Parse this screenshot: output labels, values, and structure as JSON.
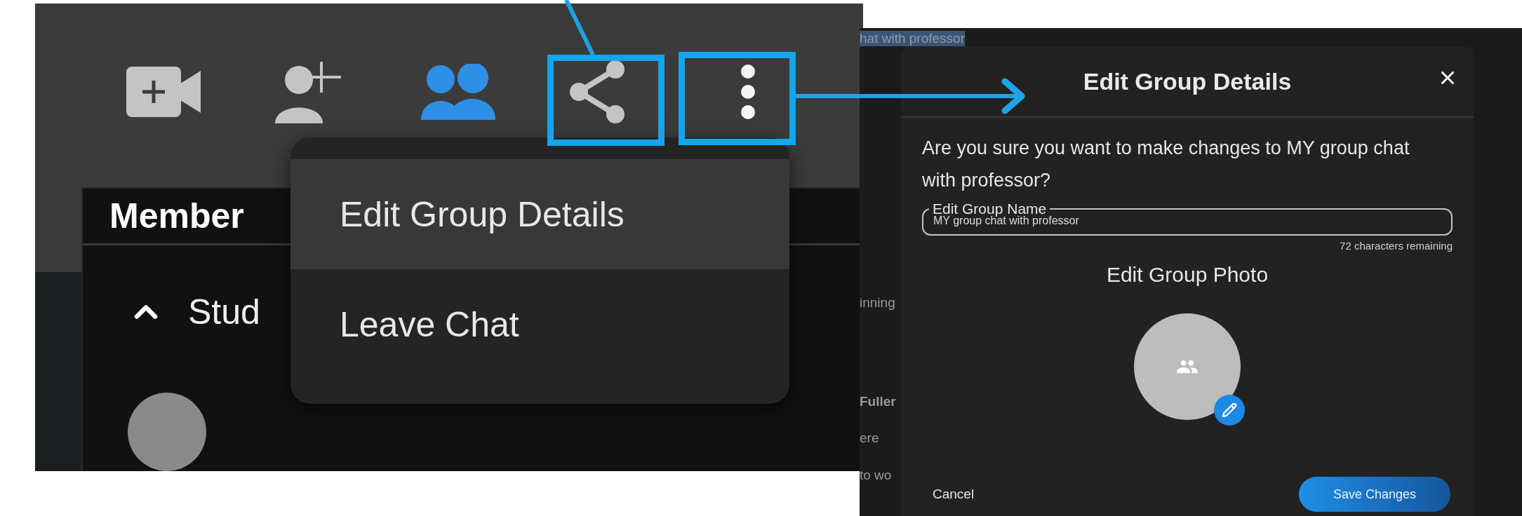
{
  "left_screen": {
    "toolbar": [
      {
        "kind": "video-add",
        "selected": false
      },
      {
        "kind": "person-add",
        "selected": false
      },
      {
        "kind": "members",
        "selected": true
      },
      {
        "kind": "share",
        "selected": false
      },
      {
        "kind": "more",
        "selected": false
      }
    ],
    "members_panel": {
      "title": "Member",
      "section": {
        "label": "Stud",
        "expanded": true
      }
    },
    "menu": {
      "items": [
        {
          "label": "Edit Group Details",
          "selected": true
        },
        {
          "label": "Leave Chat",
          "selected": false
        }
      ]
    }
  },
  "right_screen": {
    "selected_text": "hat with professor",
    "background_texts": [
      {
        "text": "inning",
        "kind": "text"
      },
      {
        "text": "Fuller",
        "kind": "name"
      },
      {
        "text": "ere",
        "kind": "text"
      },
      {
        "text": "to wo",
        "kind": "text"
      }
    ],
    "dialog": {
      "title": "Edit Group Details",
      "message": "Are you sure you want to make changes to MY group chat with professor?",
      "name_field": {
        "label": "Edit Group Name",
        "value": "MY group chat with professor",
        "counter": "72 characters remaining"
      },
      "photo_heading": "Edit Group Photo",
      "cancel": "Cancel",
      "save": "Save Changes"
    }
  }
}
